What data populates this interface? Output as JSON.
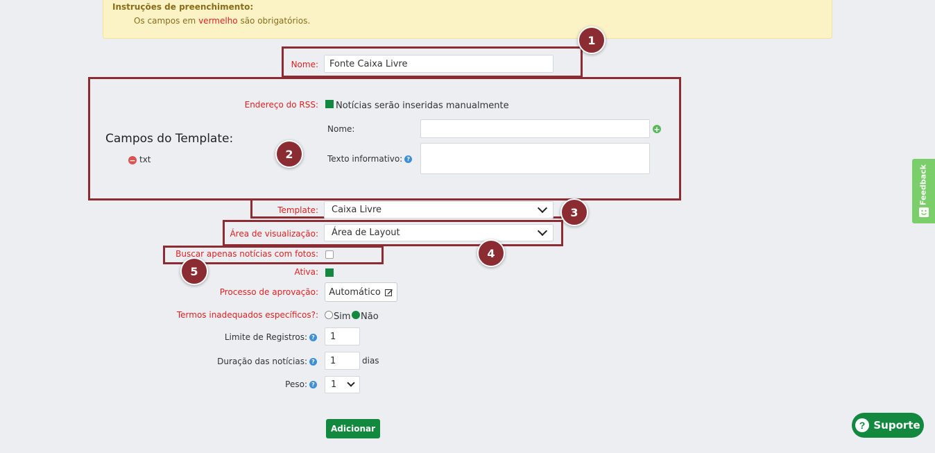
{
  "instructions": {
    "title": "Instruções de preenchimento:",
    "text_before": "Os campos em ",
    "text_highlight": "vermelho",
    "text_after": " são obrigatórios."
  },
  "form": {
    "nome": {
      "label": "Nome:",
      "value": "Fonte Caixa Livre"
    },
    "rss": {
      "label": "Endereço do RSS:",
      "checkbox_label": "Notícias serão inseridas manualmente",
      "checked": true
    },
    "template_fields": {
      "heading": "Campos do Template:",
      "items": [
        "txt"
      ],
      "nome_label": "Nome:",
      "nome_value": "",
      "texto_label": "Texto informativo:",
      "texto_value": ""
    },
    "template": {
      "label": "Template:",
      "value": "Caixa Livre"
    },
    "area": {
      "label": "Área de visualização:",
      "value": "Área de Layout"
    },
    "buscar_fotos": {
      "label": "Buscar apenas notícias com fotos:",
      "checked": false
    },
    "ativa": {
      "label": "Ativa:",
      "checked": true
    },
    "processo": {
      "label": "Processo de aprovação:",
      "button": "Automático"
    },
    "termos": {
      "label": "Termos inadequados específicos?:",
      "options": [
        "Sim",
        "Não"
      ],
      "selected": "Não"
    },
    "limite": {
      "label": "Limite de Registros:",
      "value": "1"
    },
    "duracao": {
      "label": "Duração das notícias:",
      "value": "1",
      "unit": "dias"
    },
    "peso": {
      "label": "Peso:",
      "value": "1"
    },
    "submit": "Adicionar"
  },
  "badges": [
    "1",
    "2",
    "3",
    "4",
    "5"
  ],
  "feedback_tab": "Feedback",
  "support_button": "Suporte",
  "colors": {
    "required": "#e02020",
    "highlight_box": "#8b2c32",
    "primary_green": "#13893f",
    "notice_bg": "#fbf3c6",
    "feedback_green": "#7bcf6a"
  }
}
